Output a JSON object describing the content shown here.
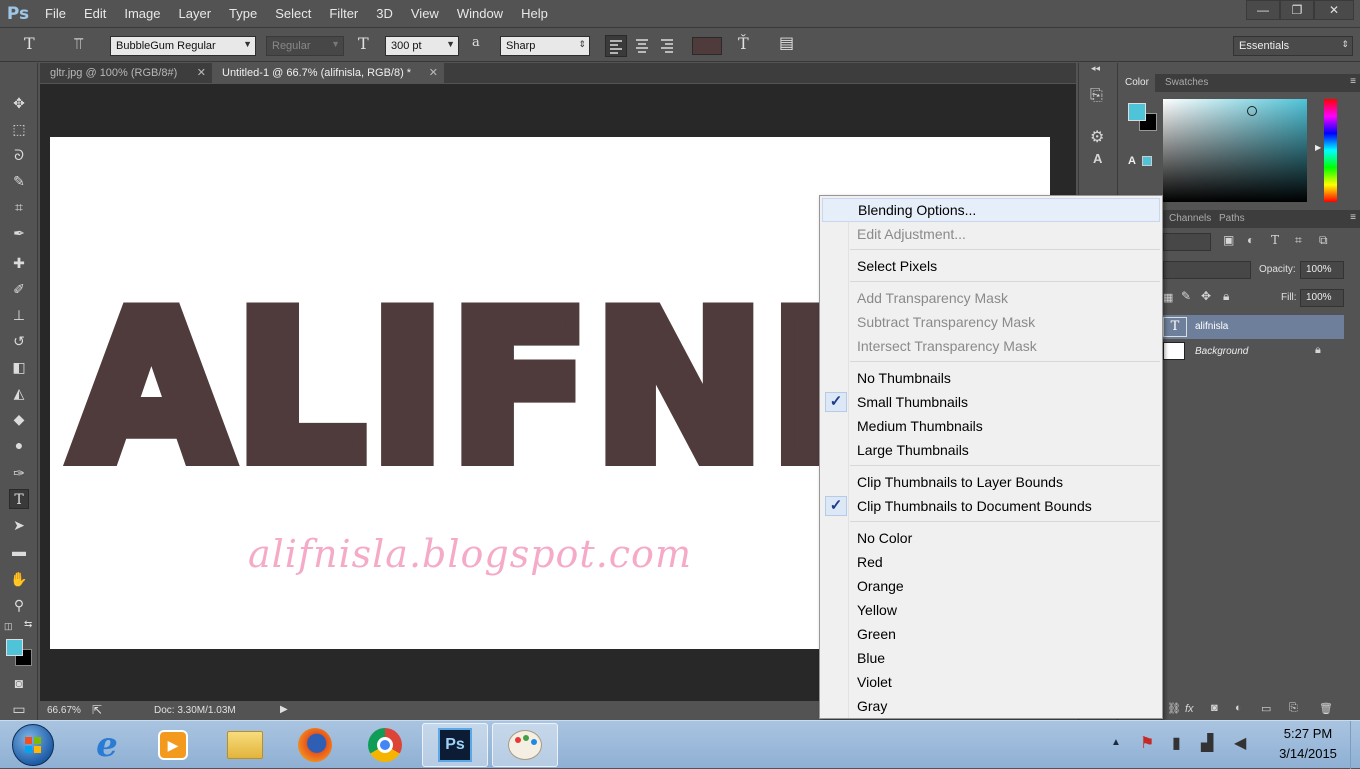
{
  "app": {
    "logo": "Ps"
  },
  "menubar": {
    "items": [
      "File",
      "Edit",
      "Image",
      "Layer",
      "Type",
      "Select",
      "Filter",
      "3D",
      "View",
      "Window",
      "Help"
    ]
  },
  "window_controls": {
    "minimize": "—",
    "restore": "❐",
    "close": "✕"
  },
  "options_bar": {
    "font_family": "BubbleGum Regular",
    "font_style": "Regular",
    "font_size": "300 pt",
    "antialias_icon": "a",
    "antialias": "Sharp",
    "text_color": "#4f3b3b",
    "workspace": "Essentials"
  },
  "tabs": [
    {
      "label": "gltr.jpg @ 100% (RGB/8#)",
      "active": false
    },
    {
      "label": "Untitled-1 @ 66.7% (alifnisla, RGB/8) *",
      "active": true
    }
  ],
  "canvas": {
    "main_text": "ALIFNISL",
    "main_text_color": "#4f3b3b",
    "url_text": "alifnisla.blogspot.com",
    "url_text_color": "#f5aac8"
  },
  "status_bar": {
    "zoom": "66.67%",
    "doc": "Doc: 3.30M/1.03M"
  },
  "color_panel": {
    "tabs": [
      "Color",
      "Swatches"
    ],
    "foreground": "#4fc3d8",
    "background": "#000000"
  },
  "layers_panel": {
    "tabs": [
      "Channels",
      "Paths"
    ],
    "opacity_label": "Opacity:",
    "opacity": "100%",
    "fill_label": "Fill:",
    "fill": "100%",
    "layers": [
      {
        "name": "alifnisla",
        "type": "text",
        "selected": true
      },
      {
        "name": "Background",
        "type": "background",
        "selected": false
      }
    ],
    "footer_icon": "fx"
  },
  "context_menu": {
    "groups": [
      [
        {
          "label": "Blending Options...",
          "disabled": false,
          "highlighted": true
        },
        {
          "label": "Edit Adjustment...",
          "disabled": true
        }
      ],
      [
        {
          "label": "Select Pixels",
          "disabled": false
        }
      ],
      [
        {
          "label": "Add Transparency Mask",
          "disabled": true
        },
        {
          "label": "Subtract Transparency Mask",
          "disabled": true
        },
        {
          "label": "Intersect Transparency Mask",
          "disabled": true
        }
      ],
      [
        {
          "label": "No Thumbnails",
          "disabled": false
        },
        {
          "label": "Small Thumbnails",
          "disabled": false,
          "checked": true
        },
        {
          "label": "Medium Thumbnails",
          "disabled": false
        },
        {
          "label": "Large Thumbnails",
          "disabled": false
        }
      ],
      [
        {
          "label": "Clip Thumbnails to Layer Bounds",
          "disabled": false
        },
        {
          "label": "Clip Thumbnails to Document Bounds",
          "disabled": false,
          "checked": true
        }
      ],
      [
        {
          "label": "No Color"
        },
        {
          "label": "Red"
        },
        {
          "label": "Orange"
        },
        {
          "label": "Yellow"
        },
        {
          "label": "Green"
        },
        {
          "label": "Blue"
        },
        {
          "label": "Violet"
        },
        {
          "label": "Gray"
        }
      ]
    ]
  },
  "taskbar": {
    "apps": [
      "start-orb",
      "internet-explorer",
      "media-player",
      "file-explorer",
      "firefox",
      "chrome",
      "photoshop",
      "paint"
    ],
    "active_app": "photoshop",
    "photoshop_label": "Ps",
    "ie_label": "e",
    "time": "5:27 PM",
    "date": "3/14/2015"
  }
}
